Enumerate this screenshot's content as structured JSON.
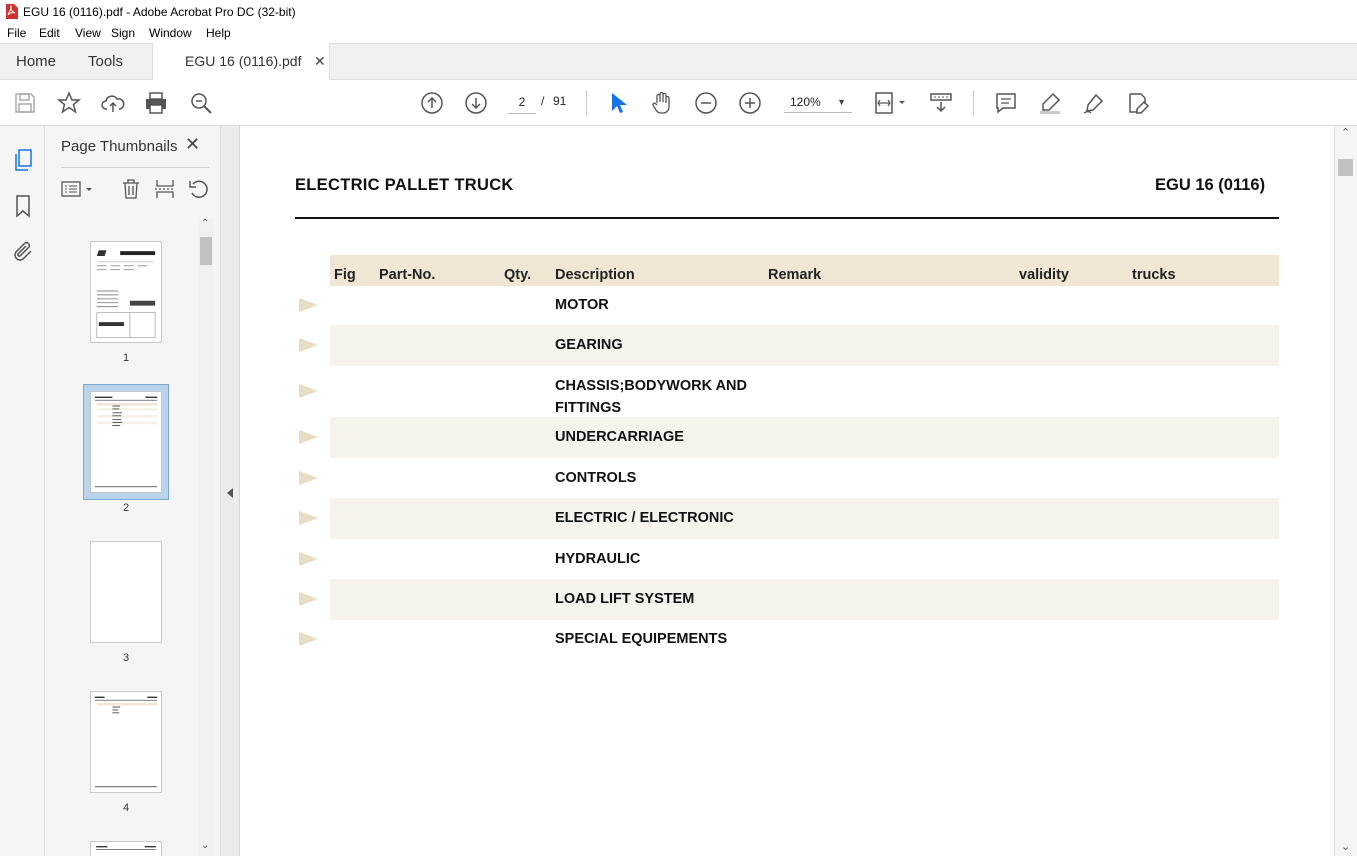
{
  "window": {
    "title": "EGU 16 (0116).pdf - Adobe Acrobat Pro DC (32-bit)"
  },
  "menu": [
    "File",
    "Edit",
    "View",
    "Sign",
    "Window",
    "Help"
  ],
  "tabs": {
    "home": "Home",
    "tools": "Tools",
    "document": "EGU 16 (0116).pdf"
  },
  "toolbar": {
    "page_current": "2",
    "page_sep": "/",
    "page_total": "91",
    "zoom": "120%"
  },
  "thumbnails": {
    "title": "Page Thumbnails",
    "pages": [
      "1",
      "2",
      "3",
      "4"
    ],
    "selected": "2"
  },
  "document": {
    "heading_left": "ELECTRIC PALLET TRUCK",
    "heading_right": "EGU 16 (0116)",
    "columns": [
      "Fig",
      "Part-No.",
      "Qty.",
      "Description",
      "Remark",
      "validity",
      "trucks"
    ],
    "rows": [
      "MOTOR",
      "GEARING",
      "CHASSIS;BODYWORK AND FITTINGS",
      "UNDERCARRIAGE",
      "CONTROLS",
      "ELECTRIC / ELECTRONIC",
      "HYDRAULIC",
      "LOAD LIFT SYSTEM",
      "SPECIAL EQUIPEMENTS"
    ],
    "row3_line1": "CHASSIS;BODYWORK AND",
    "row3_line2": "FITTINGS"
  },
  "colors": {
    "header_band": "#efe6d4",
    "row_shade": "#f5f3ec",
    "arrow": "#e8dcc4",
    "selected_thumb": "#b9d3ea"
  }
}
